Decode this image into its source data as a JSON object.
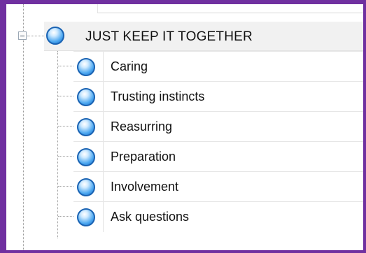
{
  "tree": {
    "root": {
      "label": "JUST KEEP IT TOGETHER",
      "icon": "blue-orb-icon",
      "expanded": true
    },
    "children": [
      {
        "label": "Caring",
        "icon": "blue-orb-icon"
      },
      {
        "label": "Trusting instincts",
        "icon": "blue-orb-icon"
      },
      {
        "label": "Reasurring",
        "icon": "blue-orb-icon"
      },
      {
        "label": "Preparation",
        "icon": "blue-orb-icon"
      },
      {
        "label": "Involvement",
        "icon": "blue-orb-icon"
      },
      {
        "label": "Ask questions",
        "icon": "blue-orb-icon"
      }
    ]
  },
  "colors": {
    "frame": "#7030a0",
    "orb": "#1a63b3",
    "root_row_bg": "#f1f1f1"
  }
}
